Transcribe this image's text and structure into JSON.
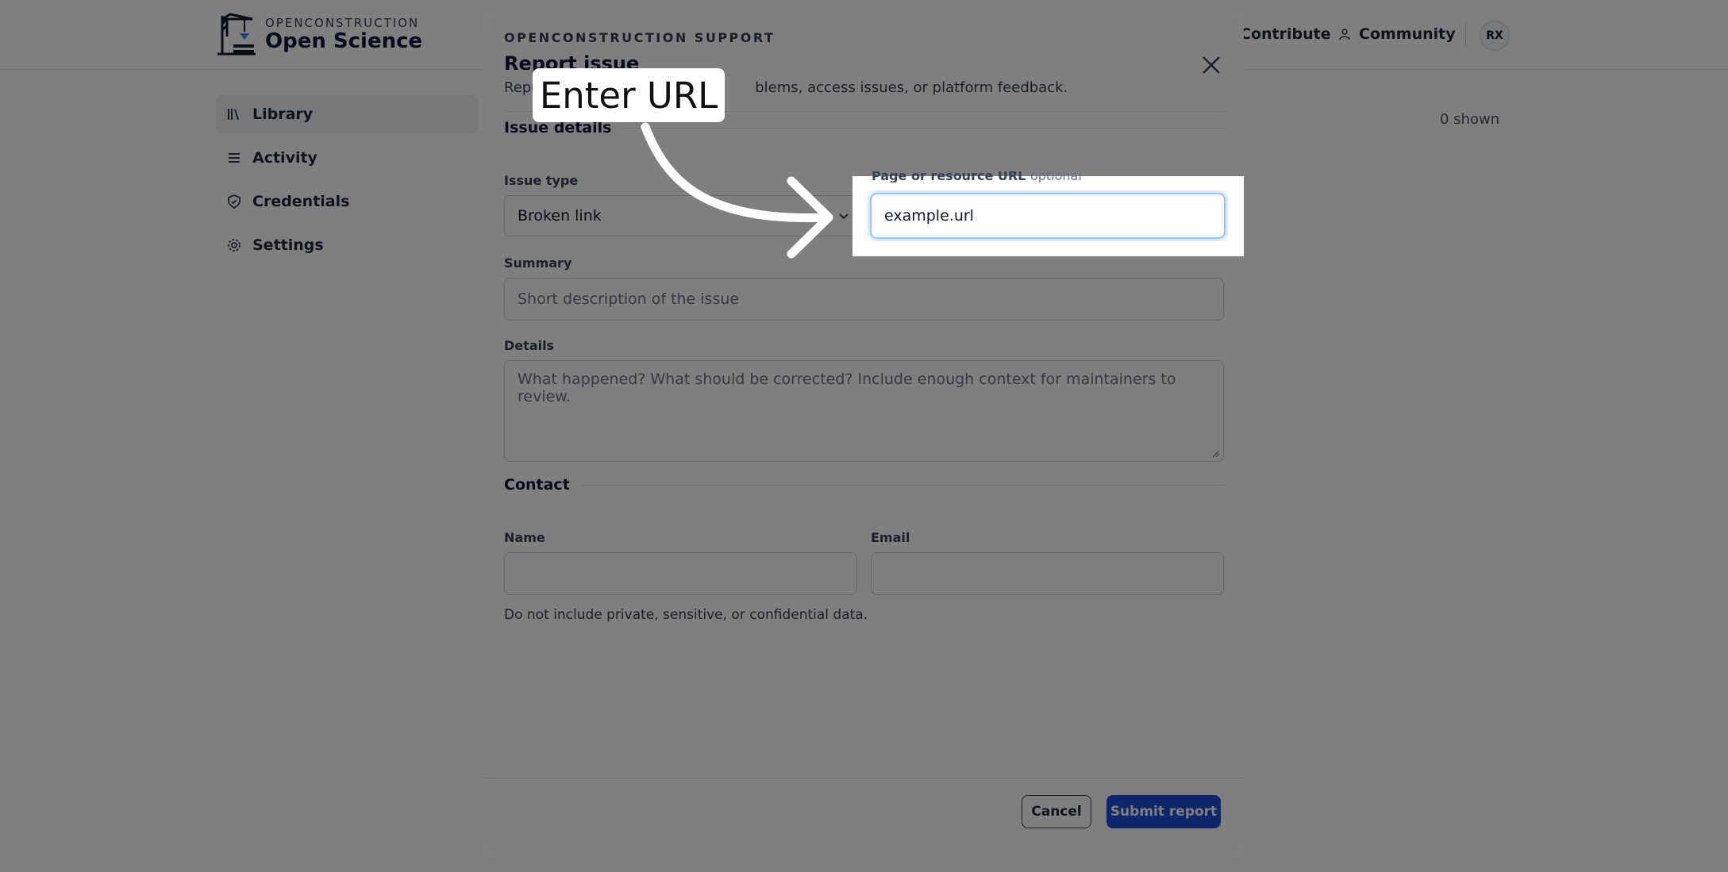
{
  "app": {
    "brand_eyebrow": "OPENCONSTRUCTION",
    "brand_name": "Open Science",
    "nav": {
      "contribute": "Contribute",
      "community": "Community"
    },
    "user_initials": "RX",
    "sidebar": [
      {
        "label": "Library",
        "icon": "library-icon",
        "active": true
      },
      {
        "label": "Activity",
        "icon": "list-icon",
        "active": false
      },
      {
        "label": "Credentials",
        "icon": "shield-icon",
        "active": false
      },
      {
        "label": "Settings",
        "icon": "gear-icon",
        "active": false
      }
    ],
    "results_count": "0 shown"
  },
  "modal": {
    "eyebrow": "OPENCONSTRUCTION SUPPORT",
    "title": "Report issue",
    "description_start": "Repo",
    "description_end": "blems, access issues, or platform feedback.",
    "issue_details_heading": "Issue details",
    "issue_type_label": "Issue type",
    "issue_type_value": "Broken link",
    "url_label": "Page or resource URL",
    "url_optional": "optional",
    "url_value": "example.url",
    "summary_label": "Summary",
    "summary_placeholder": "Short description of the issue",
    "details_label": "Details",
    "details_placeholder": "What happened? What should be corrected? Include enough context for maintainers to review.",
    "contact_heading": "Contact",
    "name_label": "Name",
    "email_label": "Email",
    "disclaimer": "Do not include private, sensitive, or confidential data.",
    "cancel_label": "Cancel",
    "submit_label": "Submit report"
  },
  "annotation": {
    "callout_text": "Enter URL"
  },
  "colors": {
    "primary": "#1d4ed8",
    "focus_ring": "#93c5fd",
    "overlay": "rgba(0,0,0,0.5)"
  }
}
